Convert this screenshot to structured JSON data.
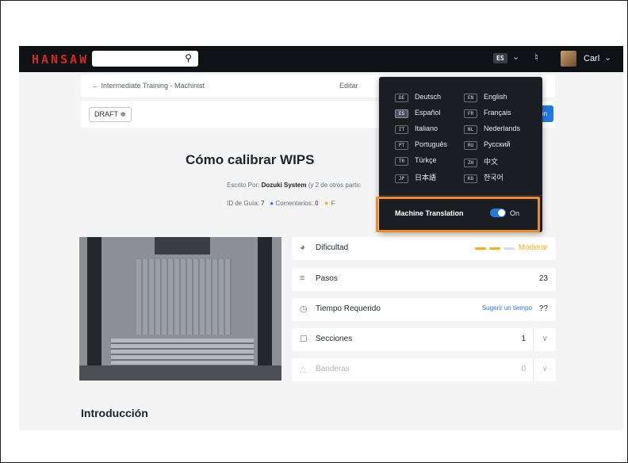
{
  "header": {
    "logo": "HANSAW",
    "search_placeholder": "",
    "language_code": "ES",
    "user_name": "Carl"
  },
  "breadcrumb": {
    "text": "← Intermediate Training - Machinist",
    "edit_label": "Editar"
  },
  "status": {
    "draft_label": "DRAFT ≑",
    "publish_label_partial": "ión"
  },
  "guide": {
    "title": "Cómo calibrar WIPS",
    "byline_prefix": "Escrito Por:",
    "byline_author": "Dozuki System",
    "byline_suffix": "(y 2 de otros partic",
    "guide_id_label": "ID de Guía:",
    "guide_id": "7",
    "comments_label": "Comentarios:",
    "comments_count": "0",
    "favorites_partial": "F"
  },
  "details": {
    "difficulty_label": "Dificultad",
    "difficulty_value": "Moderar",
    "steps_label": "Pasos",
    "steps_value": "23",
    "time_label": "Tiempo Requerido",
    "time_suggest": "Sugerir un tiempo",
    "time_value": "??",
    "sections_label": "Secciones",
    "sections_value": "1",
    "flags_label": "Banderas",
    "flags_value": "0"
  },
  "intro_heading": "Introducción",
  "languages": [
    {
      "code": "DE",
      "name": "Deutsch"
    },
    {
      "code": "EN",
      "name": "English"
    },
    {
      "code": "ES",
      "name": "Español"
    },
    {
      "code": "FR",
      "name": "Français"
    },
    {
      "code": "IT",
      "name": "Italiano"
    },
    {
      "code": "NL",
      "name": "Nederlands"
    },
    {
      "code": "PT",
      "name": "Português"
    },
    {
      "code": "RU",
      "name": "Русский"
    },
    {
      "code": "TR",
      "name": "Türkçe"
    },
    {
      "code": "ZH",
      "name": "中文"
    },
    {
      "code": "JP",
      "name": "日本語"
    },
    {
      "code": "KO",
      "name": "한국어"
    }
  ],
  "machine_translation": {
    "label": "Machine Translation",
    "state": "On"
  },
  "colors": {
    "accent": "#1f7ae0",
    "brand": "#d62b1f",
    "highlight": "#f28c1a",
    "difficulty": "#f2b20f"
  }
}
